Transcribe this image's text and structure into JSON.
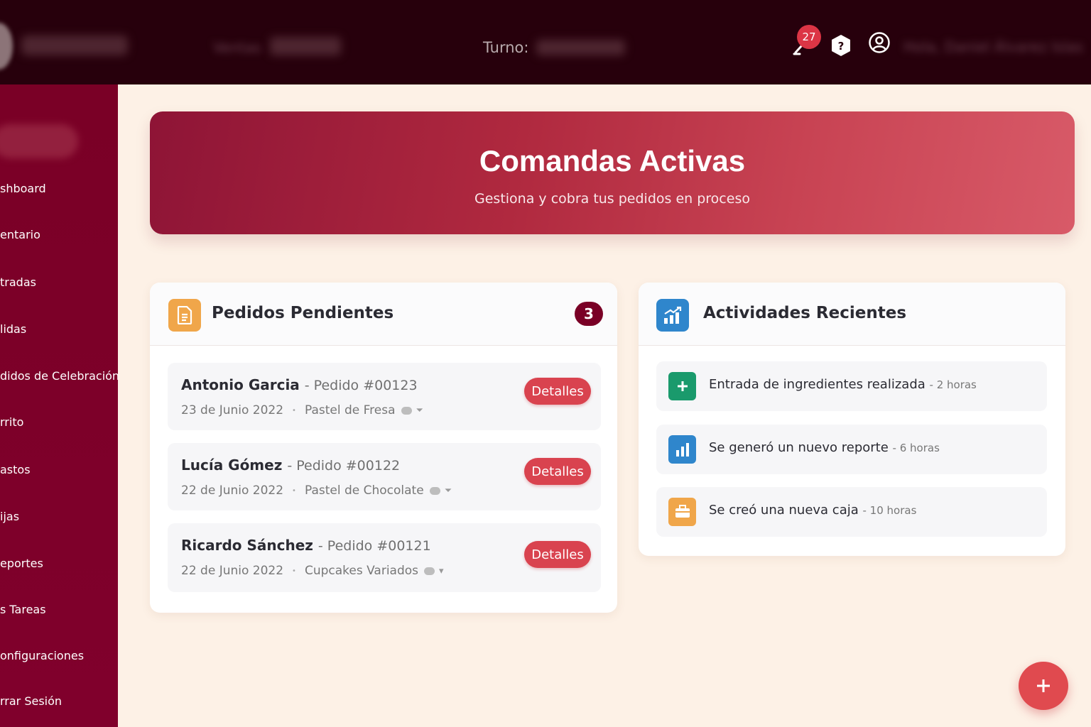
{
  "topbar": {
    "ventas_label": "Ventas",
    "turno_label": "Turno:",
    "notification_count": "27",
    "greeting": "Hola, Daniel Álvarez Islas"
  },
  "sidebar": {
    "items": [
      {
        "label": "shboard",
        "icon": "dashboard-icon"
      },
      {
        "label": "entario",
        "icon": "inventory-icon"
      },
      {
        "label": "tradas",
        "icon": "entries-icon"
      },
      {
        "label": "lidas",
        "icon": "exits-icon"
      },
      {
        "label": "didos de Celebración",
        "icon": "celebration-orders-icon"
      },
      {
        "label": "rrito",
        "icon": "cart-icon"
      },
      {
        "label": "astos",
        "icon": "expenses-icon"
      },
      {
        "label": "ijas",
        "icon": "cash-box-icon"
      },
      {
        "label": "eportes",
        "icon": "reports-icon"
      },
      {
        "label": "s Tareas",
        "icon": "tasks-icon"
      },
      {
        "label": "onfiguraciones",
        "icon": "settings-icon"
      },
      {
        "label": "rrar Sesión",
        "icon": "logout-icon"
      }
    ]
  },
  "hero": {
    "title": "Comandas Activas",
    "subtitle": "Gestiona y cobra tus pedidos en proceso"
  },
  "pending": {
    "title": "Pedidos Pendientes",
    "count": "3",
    "icon": "document-icon",
    "orders": [
      {
        "customer": "Antonio Garcia",
        "number": "- Pedido #00123",
        "date": "23 de Junio 2022",
        "product": "Pastel de Fresa",
        "button": "Detalles"
      },
      {
        "customer": "Lucía Gómez",
        "number": "- Pedido #00122",
        "date": "22 de Junio 2022",
        "product": "Pastel de Chocolate",
        "button": "Detalles"
      },
      {
        "customer": "Ricardo Sánchez",
        "number": "- Pedido #00121",
        "date": "22 de Junio 2022",
        "product": "Cupcakes Variados",
        "button": "Detalles"
      }
    ]
  },
  "activities": {
    "title": "Actividades Recientes",
    "icon": "chart-growth-icon",
    "items": [
      {
        "text": "Entrada de ingredientes realizada",
        "time": "- 2 horas",
        "icon": "plus-icon",
        "color": "#1a9a6c"
      },
      {
        "text": "Se generó un nuevo reporte",
        "time": "- 6 horas",
        "icon": "bar-chart-icon",
        "color": "#2f86cc"
      },
      {
        "text": "Se creó una nueva caja",
        "time": "- 10 horas",
        "icon": "cash-register-icon",
        "color": "#f0a64a"
      }
    ]
  },
  "colors": {
    "topbar": "#27000c",
    "sidebar": "#7a0026",
    "accent": "#d9434f",
    "badge": "#7a0026",
    "background": "#fdf1e6"
  }
}
